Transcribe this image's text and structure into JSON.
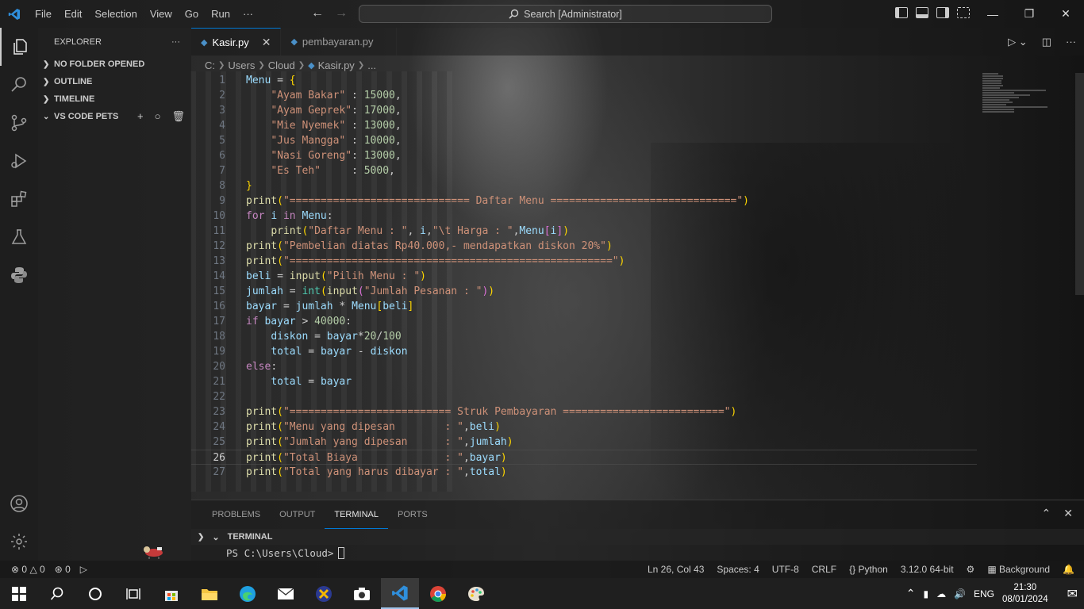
{
  "titlebar": {
    "menus": [
      "File",
      "Edit",
      "Selection",
      "View",
      "Go",
      "Run",
      "···"
    ],
    "search_placeholder": "Search [Administrator]"
  },
  "sidebar": {
    "title": "EXPLORER",
    "sections": [
      "NO FOLDER OPENED",
      "OUTLINE",
      "TIMELINE",
      "VS CODE PETS"
    ]
  },
  "tabs": [
    {
      "label": "Kasir.py",
      "active": true
    },
    {
      "label": "pembayaran.py",
      "active": false
    }
  ],
  "breadcrumb": [
    "C:",
    "Users",
    "Cloud",
    "Kasir.py",
    "..."
  ],
  "editor": {
    "current_line": 26,
    "lines": [
      "Menu = {",
      "    \"Ayam Bakar\" : 15000,",
      "    \"Ayam Geprek\": 17000,",
      "    \"Mie Nyemek\" : 13000,",
      "    \"Jus Mangga\" : 10000,",
      "    \"Nasi Goreng\": 13000,",
      "    \"Es Teh\"     : 5000,",
      "}",
      "print(\"============================= Daftar Menu ==============================\")",
      "for i in Menu:",
      "    print(\"Daftar Menu : \", i,\"\\t Harga : \",Menu[i])",
      "print(\"Pembelian diatas Rp40.000,- mendapatkan diskon 20%\")",
      "print(\"====================================================\")",
      "beli = input(\"Pilih Menu : \")",
      "jumlah = int(input(\"Jumlah Pesanan : \"))",
      "bayar = jumlah * Menu[beli]",
      "if bayar > 40000:",
      "    diskon = bayar*20/100",
      "    total = bayar - diskon",
      "else:",
      "    total = bayar",
      "",
      "print(\"========================== Struk Pembayaran ==========================\")",
      "print(\"Menu yang dipesan        : \",beli)",
      "print(\"Jumlah yang dipesan      : \",jumlah)",
      "print(\"Total Biaya              : \",bayar)",
      "print(\"Total yang harus dibayar : \",total)"
    ]
  },
  "panel": {
    "tabs": [
      "PROBLEMS",
      "OUTPUT",
      "TERMINAL",
      "PORTS"
    ],
    "active_tab": "TERMINAL",
    "terminal_header": "TERMINAL",
    "prompt": "PS C:\\Users\\Cloud>"
  },
  "statusbar": {
    "errors": "0",
    "warnings": "0",
    "ports": "0",
    "position": "Ln 26, Col 43",
    "spaces": "Spaces: 4",
    "encoding": "UTF-8",
    "eol": "CRLF",
    "language": "Python",
    "interpreter": "3.12.0 64-bit",
    "background": "Background"
  },
  "taskbar": {
    "language": "ENG",
    "time": "21:30",
    "date": "08/01/2024"
  },
  "colors": {
    "accent": "#0078d4",
    "keyword": "#c586c0",
    "string": "#ce9178",
    "number": "#b5cea8",
    "variable": "#9cdcfe",
    "function": "#dcdcaa"
  }
}
